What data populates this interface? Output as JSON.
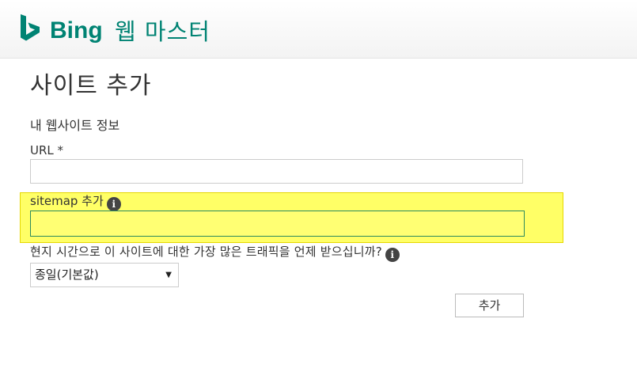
{
  "header": {
    "logo_text": "Bing",
    "product_name": "웹 마스터",
    "brand_color": "#008373"
  },
  "page": {
    "title": "사이트 추가",
    "section_title": "내 웹사이트 정보"
  },
  "form": {
    "url_label": "URL *",
    "url_value": "",
    "sitemap_label": "sitemap 추가",
    "sitemap_value": "",
    "info_glyph": "i",
    "frequency_label": "현지 시간으로 이 사이트에 대한 가장 많은 트래픽을 언제 받으십니까?",
    "frequency_selected": "종일(기본값)",
    "add_button_label": "추가"
  },
  "highlight_color": "#ffff66",
  "icons": [
    "bing-logo-icon",
    "info-icon",
    "dropdown-arrow-icon"
  ]
}
